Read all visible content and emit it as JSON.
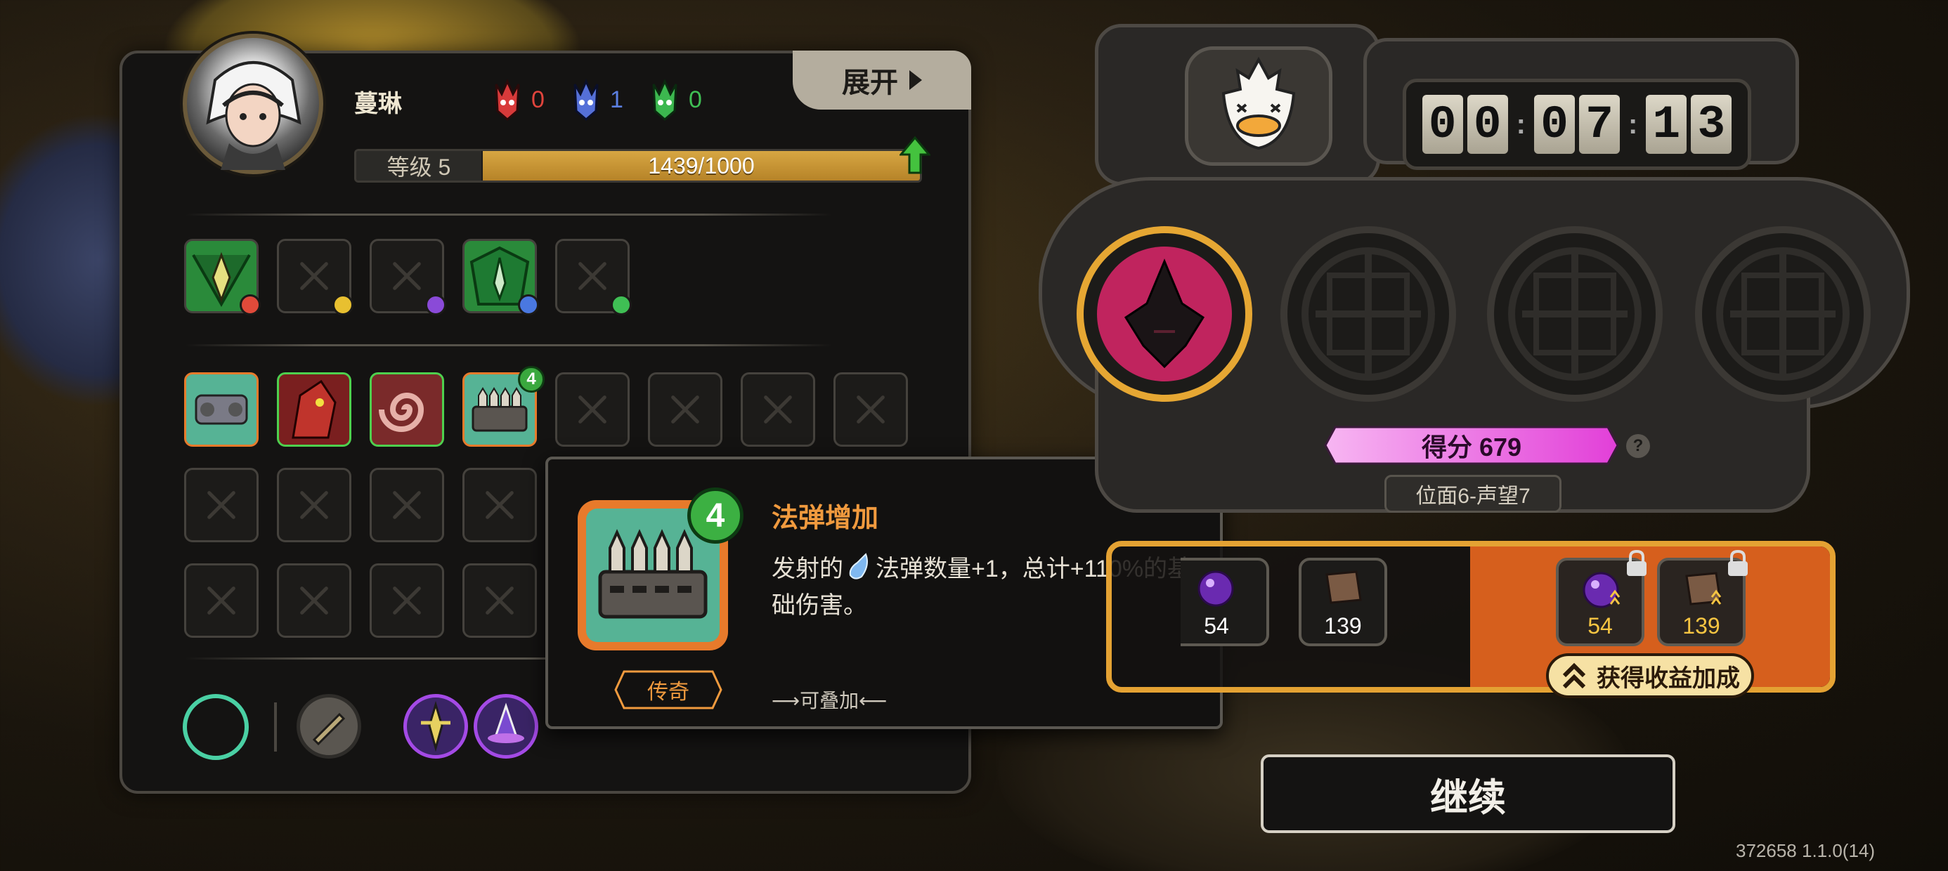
{
  "character": {
    "name": "蔓琳",
    "expand_label": "展开",
    "resources": [
      {
        "icon": "red-mask-icon",
        "value": "0",
        "color": "#e0443c"
      },
      {
        "icon": "blue-mask-icon",
        "value": "1",
        "color": "#5b7fe0"
      },
      {
        "icon": "green-mask-icon",
        "value": "0",
        "color": "#3fbf54"
      }
    ],
    "level_label": "等级 5",
    "xp_text": "1439/1000",
    "xp_fraction": 1.0
  },
  "tooltip": {
    "stack_count": "4",
    "title": "法弹增加",
    "desc_before": "发射的",
    "desc_after": "法弹数量+1，总计+110%的基础伤害。",
    "rarity": "传奇",
    "stackable": "⟶可叠加⟵"
  },
  "run": {
    "timer_digits": [
      "0",
      "0",
      "0",
      "7",
      "1",
      "3"
    ],
    "score_text": "得分 679",
    "help_label": "?",
    "location": "位面6-声望7"
  },
  "rewards": {
    "base": [
      {
        "icon": "purple-orb-icon",
        "value": "54"
      },
      {
        "icon": "book-icon",
        "value": "139"
      }
    ],
    "boosted": [
      {
        "icon": "purple-orb-icon",
        "value": "54"
      },
      {
        "icon": "book-icon",
        "value": "139"
      }
    ],
    "bonus_button": "获得收益加成"
  },
  "continue_label": "继续",
  "version": "372658 1.1.0(14)",
  "colors": {
    "accent_orange": "#d65f1d",
    "gold": "#e4a233",
    "score_pink": "#e43cd6",
    "legendary": "#f09a3e"
  }
}
